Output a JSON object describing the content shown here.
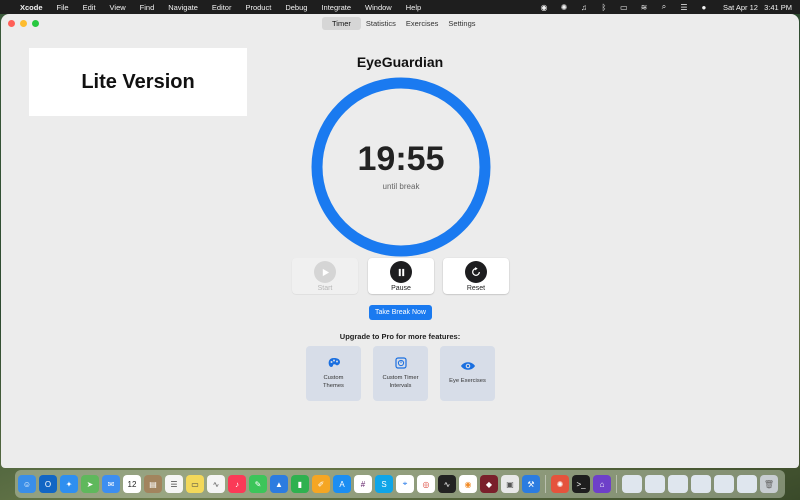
{
  "menubar": {
    "app": "Xcode",
    "items": [
      "File",
      "Edit",
      "View",
      "Find",
      "Navigate",
      "Editor",
      "Product",
      "Debug",
      "Integrate",
      "Window",
      "Help"
    ],
    "date": "Sat Apr 12",
    "time": "3:41 PM"
  },
  "tabs": [
    "Timer",
    "Statistics",
    "Exercises",
    "Settings"
  ],
  "active_tab": "Timer",
  "lite_label": "Lite Version",
  "app_title": "EyeGuardian",
  "timer": {
    "time": "19:55",
    "subtitle": "until break",
    "progress": 1.0,
    "ring_color": "#1a7af0"
  },
  "controls": {
    "start": "Start",
    "pause": "Pause",
    "reset": "Reset"
  },
  "take_break": "Take Break Now",
  "upgrade": {
    "heading": "Upgrade to Pro for more features:",
    "features": [
      "Custom Themes",
      "Custom Timer Intervals",
      "Eye Exercises"
    ]
  },
  "dock": {
    "icons": [
      "finder-icon",
      "outlook-icon",
      "safari-icon",
      "maps-icon",
      "mail-icon",
      "calendar-icon",
      "notes-icon",
      "reminders-icon",
      "stickies-icon",
      "freeform-icon",
      "music-icon",
      "messages-icon",
      "keynote-icon",
      "numbers-icon",
      "pages-icon",
      "app-store-icon",
      "slack-icon",
      "skype-icon",
      "maps-pin-icon",
      "chrome-icon",
      "activity-icon",
      "overcast-icon",
      "retcon-icon",
      "preview-icon",
      "xcode-icon",
      "terminal-icon",
      "github-icon"
    ],
    "calendar_day": "12"
  }
}
